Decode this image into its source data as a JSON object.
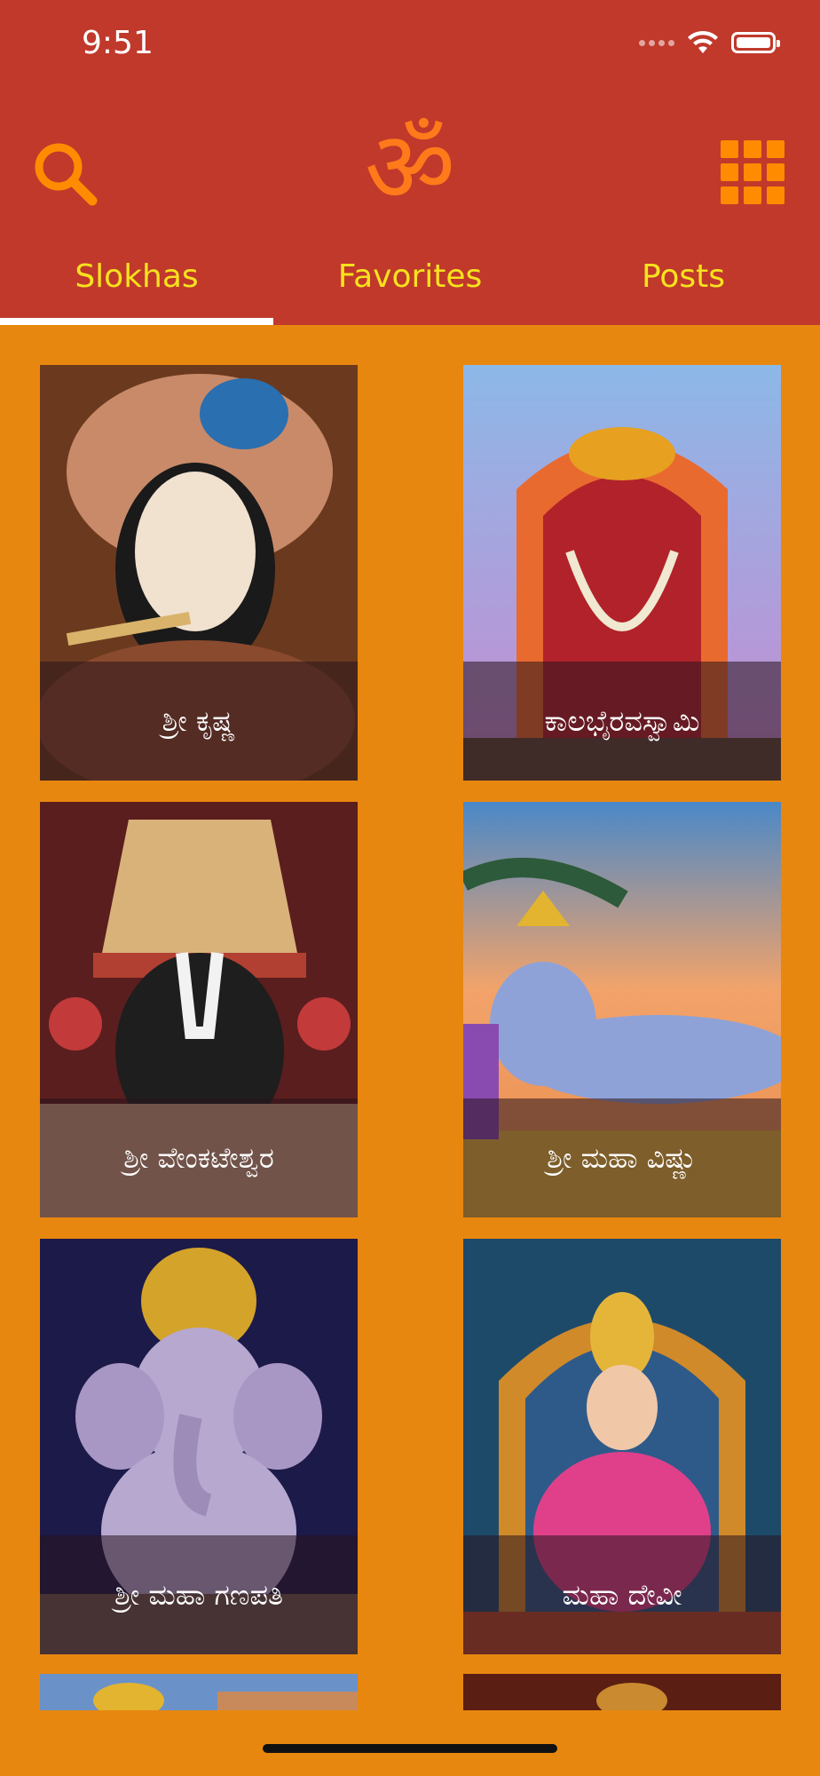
{
  "status_bar": {
    "time": "9:51"
  },
  "header": {
    "logo_glyph": "ॐ",
    "colors": {
      "background": "#C0392B",
      "accent": "#FF8C00",
      "tab_text": "#F7E21E"
    }
  },
  "tabs": [
    {
      "label": "Slokhas",
      "selected": true
    },
    {
      "label": "Favorites",
      "selected": false
    },
    {
      "label": "Posts",
      "selected": false
    }
  ],
  "cards": [
    {
      "label": "ಶ್ರೀ ಕೃಷ್ಣ"
    },
    {
      "label": "ಕಾಲಭೈರವಸ್ವಾಮಿ"
    },
    {
      "label": "ಶ್ರೀ ವೇಂಕಟೇಶ್ವರ"
    },
    {
      "label": "ಶ್ರೀ ಮಹಾ ವಿಷ್ಣು"
    },
    {
      "label": "ಶ್ರೀ ಮಹಾ ಗಣಪತಿ"
    },
    {
      "label": "ಮಹಾ ದೇವೀ"
    },
    {
      "label": ""
    },
    {
      "label": ""
    }
  ],
  "icons": {
    "search": "search-icon",
    "menu": "grid-menu-icon",
    "logo": "om-icon"
  }
}
